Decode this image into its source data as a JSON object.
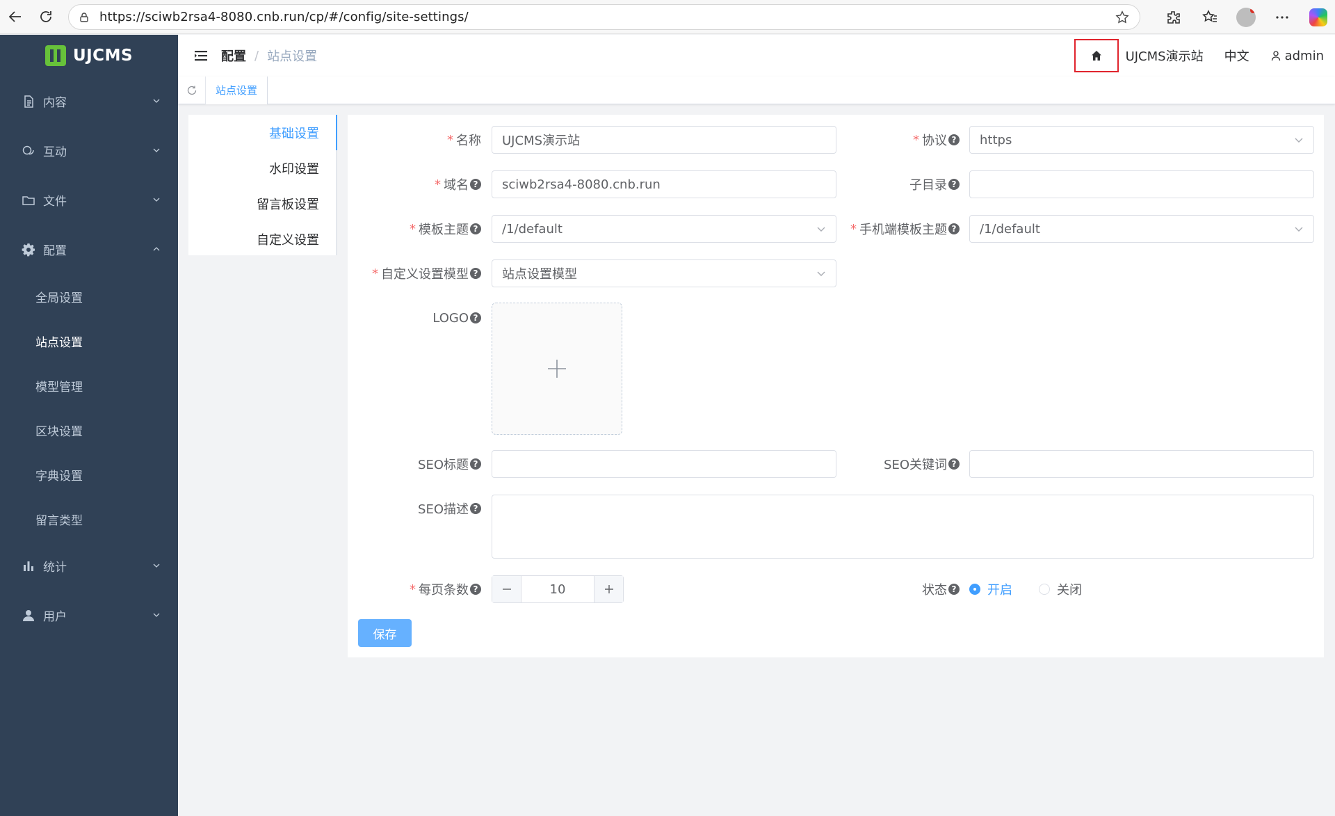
{
  "browser": {
    "url": "https://sciwb2rsa4-8080.cnb.run/cp/#/config/site-settings/"
  },
  "sidebar": {
    "logo_text": "UJCMS",
    "menus": {
      "content": "内容",
      "interaction": "互动",
      "files": "文件",
      "config": "配置",
      "stats": "统计",
      "users": "用户"
    },
    "config_sub": [
      "全局设置",
      "站点设置",
      "模型管理",
      "区块设置",
      "字典设置",
      "留言类型"
    ]
  },
  "header": {
    "breadcrumb_parent": "配置",
    "breadcrumb_sep": "/",
    "breadcrumb_current": "站点设置",
    "site_name": "UJCMS演示站",
    "language": "中文",
    "user": "admin"
  },
  "tags": {
    "active": "站点设置"
  },
  "settings_menu": [
    "基础设置",
    "水印设置",
    "留言板设置",
    "自定义设置"
  ],
  "form": {
    "name_label": "名称",
    "name_value": "UJCMS演示站",
    "protocol_label": "协议",
    "protocol_value": "https",
    "domain_label": "域名",
    "domain_value": "sciwb2rsa4-8080.cnb.run",
    "subdir_label": "子目录",
    "subdir_value": "",
    "theme_label": "模板主题",
    "theme_value": "/1/default",
    "mobile_theme_label": "手机端模板主题",
    "mobile_theme_value": "/1/default",
    "custom_model_label": "自定义设置模型",
    "custom_model_value": "站点设置模型",
    "logo_label": "LOGO",
    "seo_title_label": "SEO标题",
    "seo_keywords_label": "SEO关键词",
    "seo_desc_label": "SEO描述",
    "page_size_label": "每页条数",
    "page_size_value": "10",
    "status_label": "状态",
    "status_on": "开启",
    "status_off": "关闭",
    "save_label": "保存",
    "required_mark": "*",
    "help_mark": "?"
  },
  "colors": {
    "sidebar_bg": "#304156",
    "primary": "#409eff",
    "required": "#f56c6c",
    "home_highlight": "#e0242d"
  }
}
